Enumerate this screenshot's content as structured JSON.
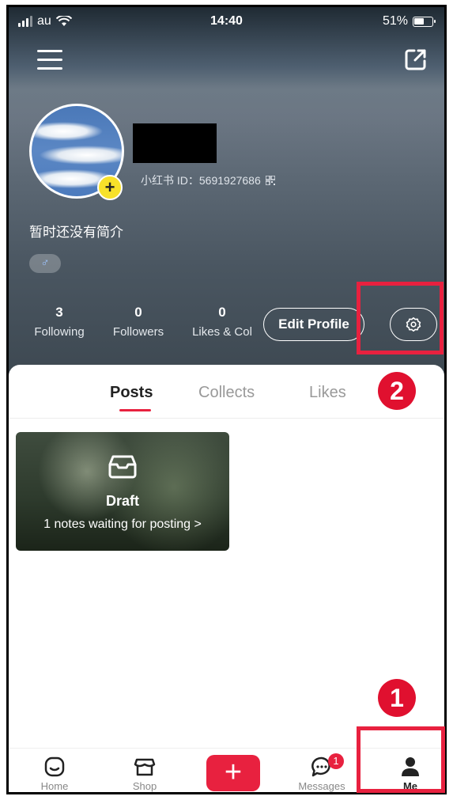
{
  "status_bar": {
    "carrier": "au",
    "time": "14:40",
    "battery": "51%"
  },
  "profile": {
    "user_id": "小红书 ID：5691927686",
    "bio": "暂时还没有简介",
    "gender_symbol": "♂",
    "avatar_add": "+"
  },
  "stats": [
    {
      "value": "3",
      "label": "Following"
    },
    {
      "value": "0",
      "label": "Followers"
    },
    {
      "value": "0",
      "label": "Likes & Col"
    }
  ],
  "buttons": {
    "edit_profile": "Edit Profile"
  },
  "tabs": [
    "Posts",
    "Collects",
    "Likes"
  ],
  "draft": {
    "title": "Draft",
    "subtitle": "1 notes waiting for posting >"
  },
  "tabbar": {
    "home": "Home",
    "shop": "Shop",
    "post": "+",
    "messages": "Messages",
    "me": "Me",
    "messages_badge": "1"
  },
  "annotations": {
    "step_one": "1",
    "step_two": "2"
  },
  "colors": {
    "accent": "#e8213f",
    "annotation": "#e0102f"
  }
}
